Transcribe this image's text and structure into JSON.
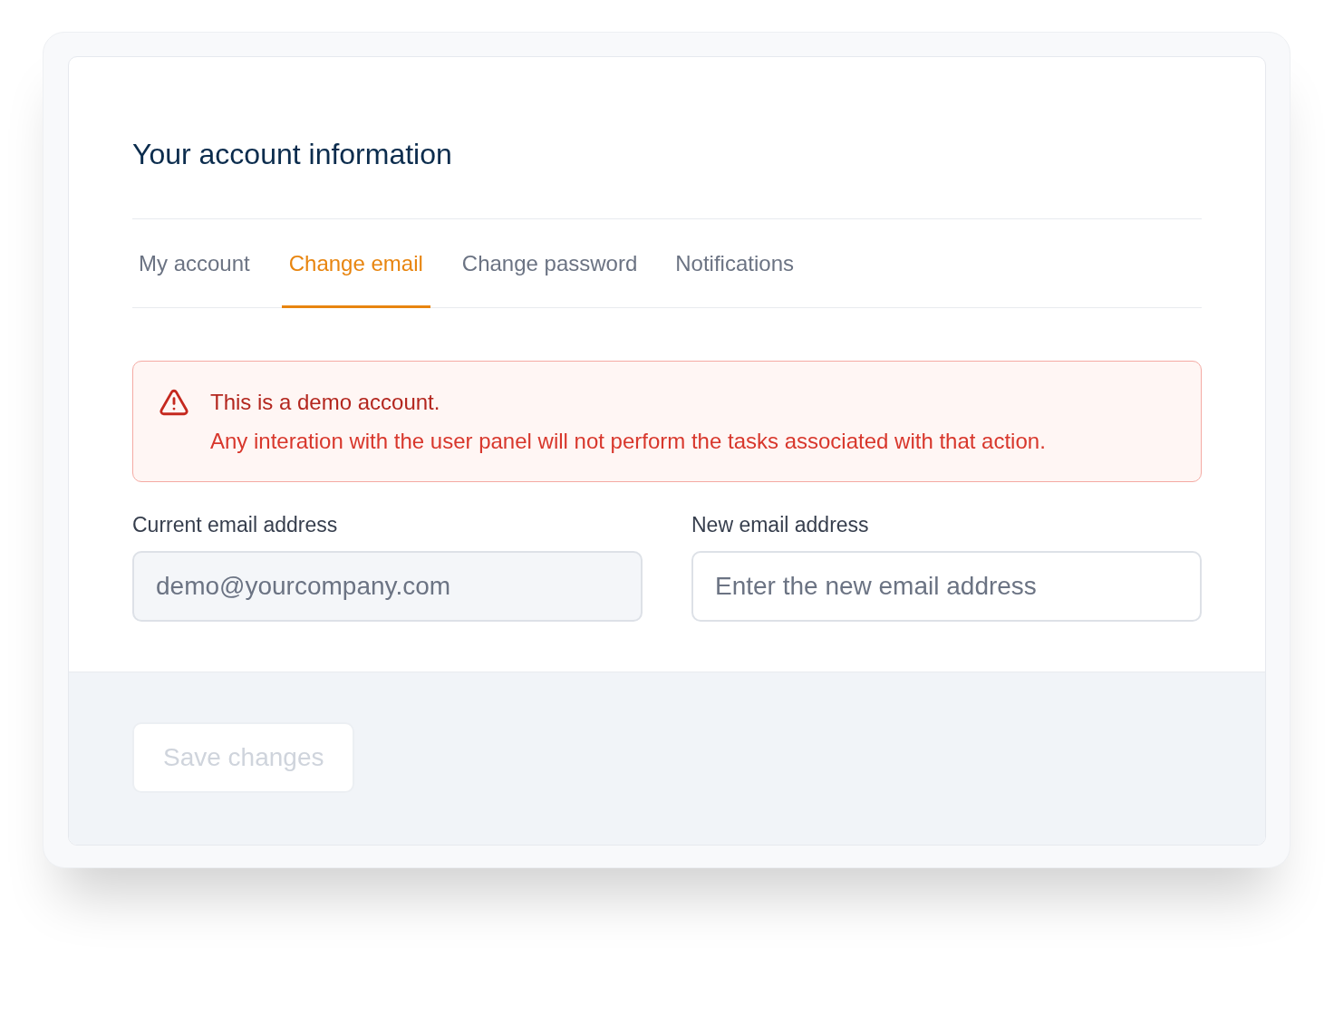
{
  "card": {
    "title": "Your account information"
  },
  "tabs": [
    {
      "label": "My account",
      "selected": false
    },
    {
      "label": "Change email",
      "selected": true
    },
    {
      "label": "Change password",
      "selected": false
    },
    {
      "label": "Notifications",
      "selected": false
    }
  ],
  "alert": {
    "title": "This is a demo account.",
    "message": "Any interation with the user panel will not perform the tasks associated with that action."
  },
  "fields": [
    {
      "label": "Current email address",
      "value": "demo@yourcompany.com",
      "disabled": true
    },
    {
      "label": "New email address",
      "placeholder": "Enter the new email address",
      "disabled": false
    }
  ],
  "footer": {
    "buttons": [
      {
        "label": "Save changes",
        "disabled": true
      }
    ]
  }
}
